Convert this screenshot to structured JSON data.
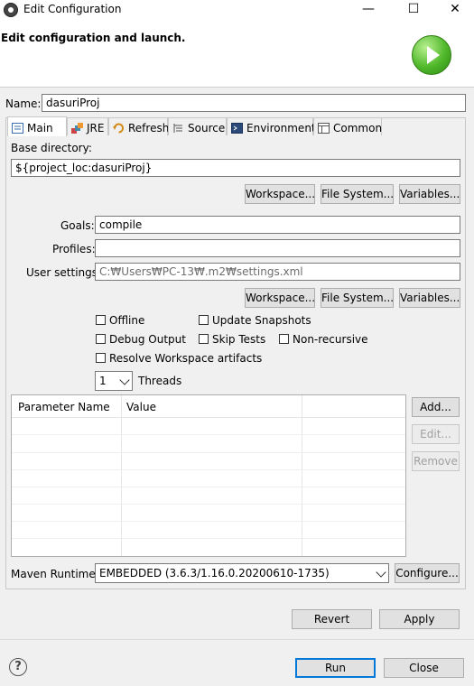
{
  "window": {
    "title": "Edit Configuration",
    "minimize": "—",
    "maximize": "☐",
    "close": "✕"
  },
  "header": {
    "heading": "Edit configuration and launch."
  },
  "name": {
    "label": "Name:",
    "value": "dasuriProj"
  },
  "tabs": [
    {
      "label": "Main",
      "icon": "main-tab-icon"
    },
    {
      "label": "JRE",
      "icon": "jre-icon"
    },
    {
      "label": "Refresh",
      "icon": "refresh-icon"
    },
    {
      "label": "Source",
      "icon": "source-icon"
    },
    {
      "label": "Environment",
      "icon": "environment-icon"
    },
    {
      "label": "Common",
      "icon": "common-icon"
    }
  ],
  "base_directory": {
    "label": "Base directory:",
    "value": "${project_loc:dasuriProj}",
    "buttons": {
      "workspace": "Workspace...",
      "file_system": "File System...",
      "variables": "Variables..."
    }
  },
  "goals": {
    "label": "Goals:",
    "value": "compile"
  },
  "profiles": {
    "label": "Profiles:",
    "value": ""
  },
  "user_settings": {
    "label": "User settings:",
    "value": "C:₩Users₩PC-13₩.m2₩settings.xml",
    "buttons": {
      "workspace": "Workspace...",
      "file_system": "File System...",
      "variables": "Variables..."
    }
  },
  "options": {
    "offline": "Offline",
    "update_snapshots": "Update Snapshots",
    "debug_output": "Debug Output",
    "skip_tests": "Skip Tests",
    "non_recursive": "Non-recursive",
    "resolve_workspace": "Resolve Workspace artifacts"
  },
  "threads": {
    "value": "1",
    "label": "Threads"
  },
  "parameters": {
    "columns": [
      "Parameter Name",
      "Value"
    ],
    "buttons": {
      "add": "Add...",
      "edit": "Edit...",
      "remove": "Remove"
    }
  },
  "runtime": {
    "label": "Maven Runtime:",
    "value": "EMBEDDED (3.6.3/1.16.0.20200610-1735)",
    "configure": "Configure..."
  },
  "actions": {
    "revert": "Revert",
    "apply": "Apply",
    "run": "Run",
    "close": "Close",
    "help": "?"
  },
  "colors": {
    "accent": "#0078d7",
    "run_green": "#4fb82a"
  }
}
